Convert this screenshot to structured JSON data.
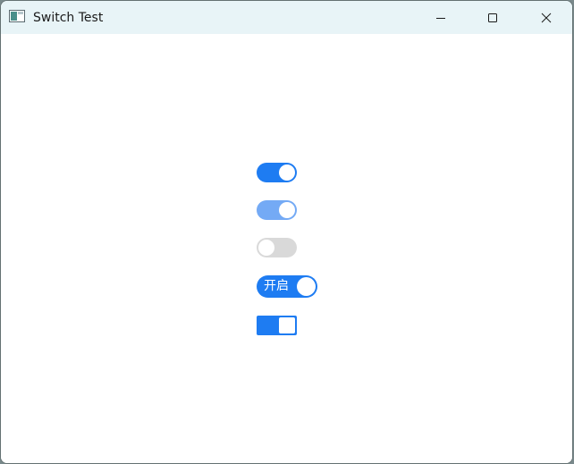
{
  "window": {
    "title": "Switch Test",
    "icon": "app-window-icon",
    "controls": {
      "minimize_icon": "minimize-icon",
      "maximize_icon": "maximize-icon",
      "close_icon": "close-icon"
    }
  },
  "switches": [
    {
      "state": "on",
      "style": "round",
      "enabled": true,
      "color": "#1e7cf2"
    },
    {
      "state": "on",
      "style": "round",
      "enabled": false,
      "color": "#74aaf5"
    },
    {
      "state": "off",
      "style": "round",
      "enabled": true,
      "color": "#d9d9d9"
    },
    {
      "state": "on",
      "style": "round-with-text",
      "enabled": true,
      "label": "开启",
      "color": "#1e7cf2"
    },
    {
      "state": "on",
      "style": "square",
      "enabled": true,
      "color": "#1e7cf2"
    }
  ]
}
